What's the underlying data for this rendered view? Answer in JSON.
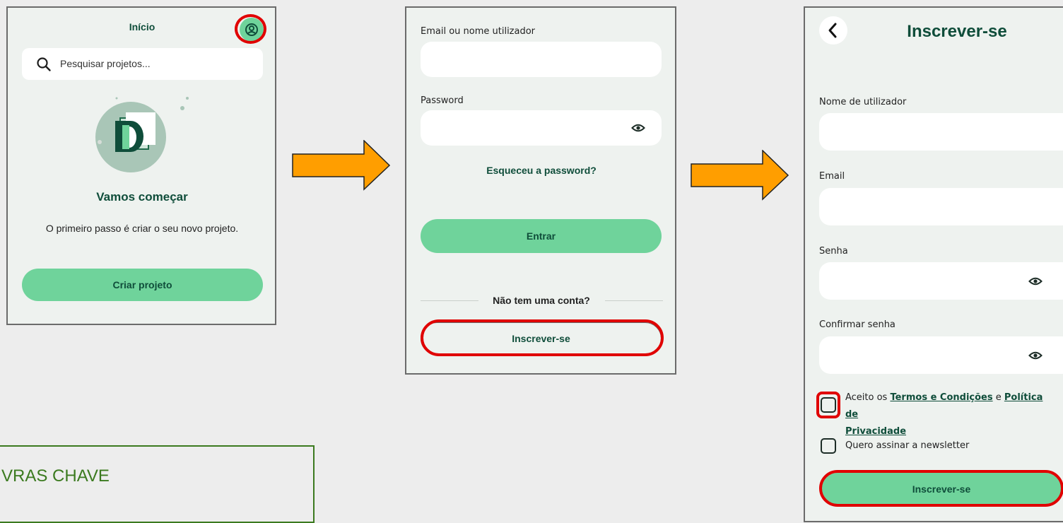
{
  "screen1": {
    "title": "Início",
    "search_placeholder": "Pesquisar projetos...",
    "heading": "Vamos começar",
    "description": "O primeiro passo é criar o seu novo projeto.",
    "create_button": "Criar projeto",
    "profile_icon": "user-circle-icon",
    "search_icon": "search-icon"
  },
  "screen2": {
    "email_label": "Email ou nome utilizador",
    "password_label": "Password",
    "forgot_link": "Esqueceu a password?",
    "login_button": "Entrar",
    "no_account": "Não tem uma conta?",
    "signup_button": "Inscrever-se",
    "eye_icon": "eye-icon"
  },
  "screen3": {
    "title": "Inscrever-se",
    "back_icon": "chevron-left-icon",
    "username_label": "Nome de utilizador",
    "email_label": "Email",
    "password_label": "Senha",
    "confirm_label": "Confirmar senha",
    "terms_prefix": "Aceito os ",
    "terms_link": "Termos e Condições",
    "terms_and": " e ",
    "privacy_link_1": "Política de",
    "privacy_link_2": "Privacidade",
    "newsletter_label": "Quero assinar a newsletter",
    "signup_button": "Inscrever-se"
  },
  "keywords_box": {
    "title": "VRAS CHAVE"
  },
  "colors": {
    "accent_green": "#6fd39b",
    "dark_green": "#0f4d3a",
    "highlight_red": "#e00000",
    "arrow_orange": "#ff9e00",
    "panel_bg": "#eef2ef",
    "keyword_border": "#3b7a1f"
  }
}
